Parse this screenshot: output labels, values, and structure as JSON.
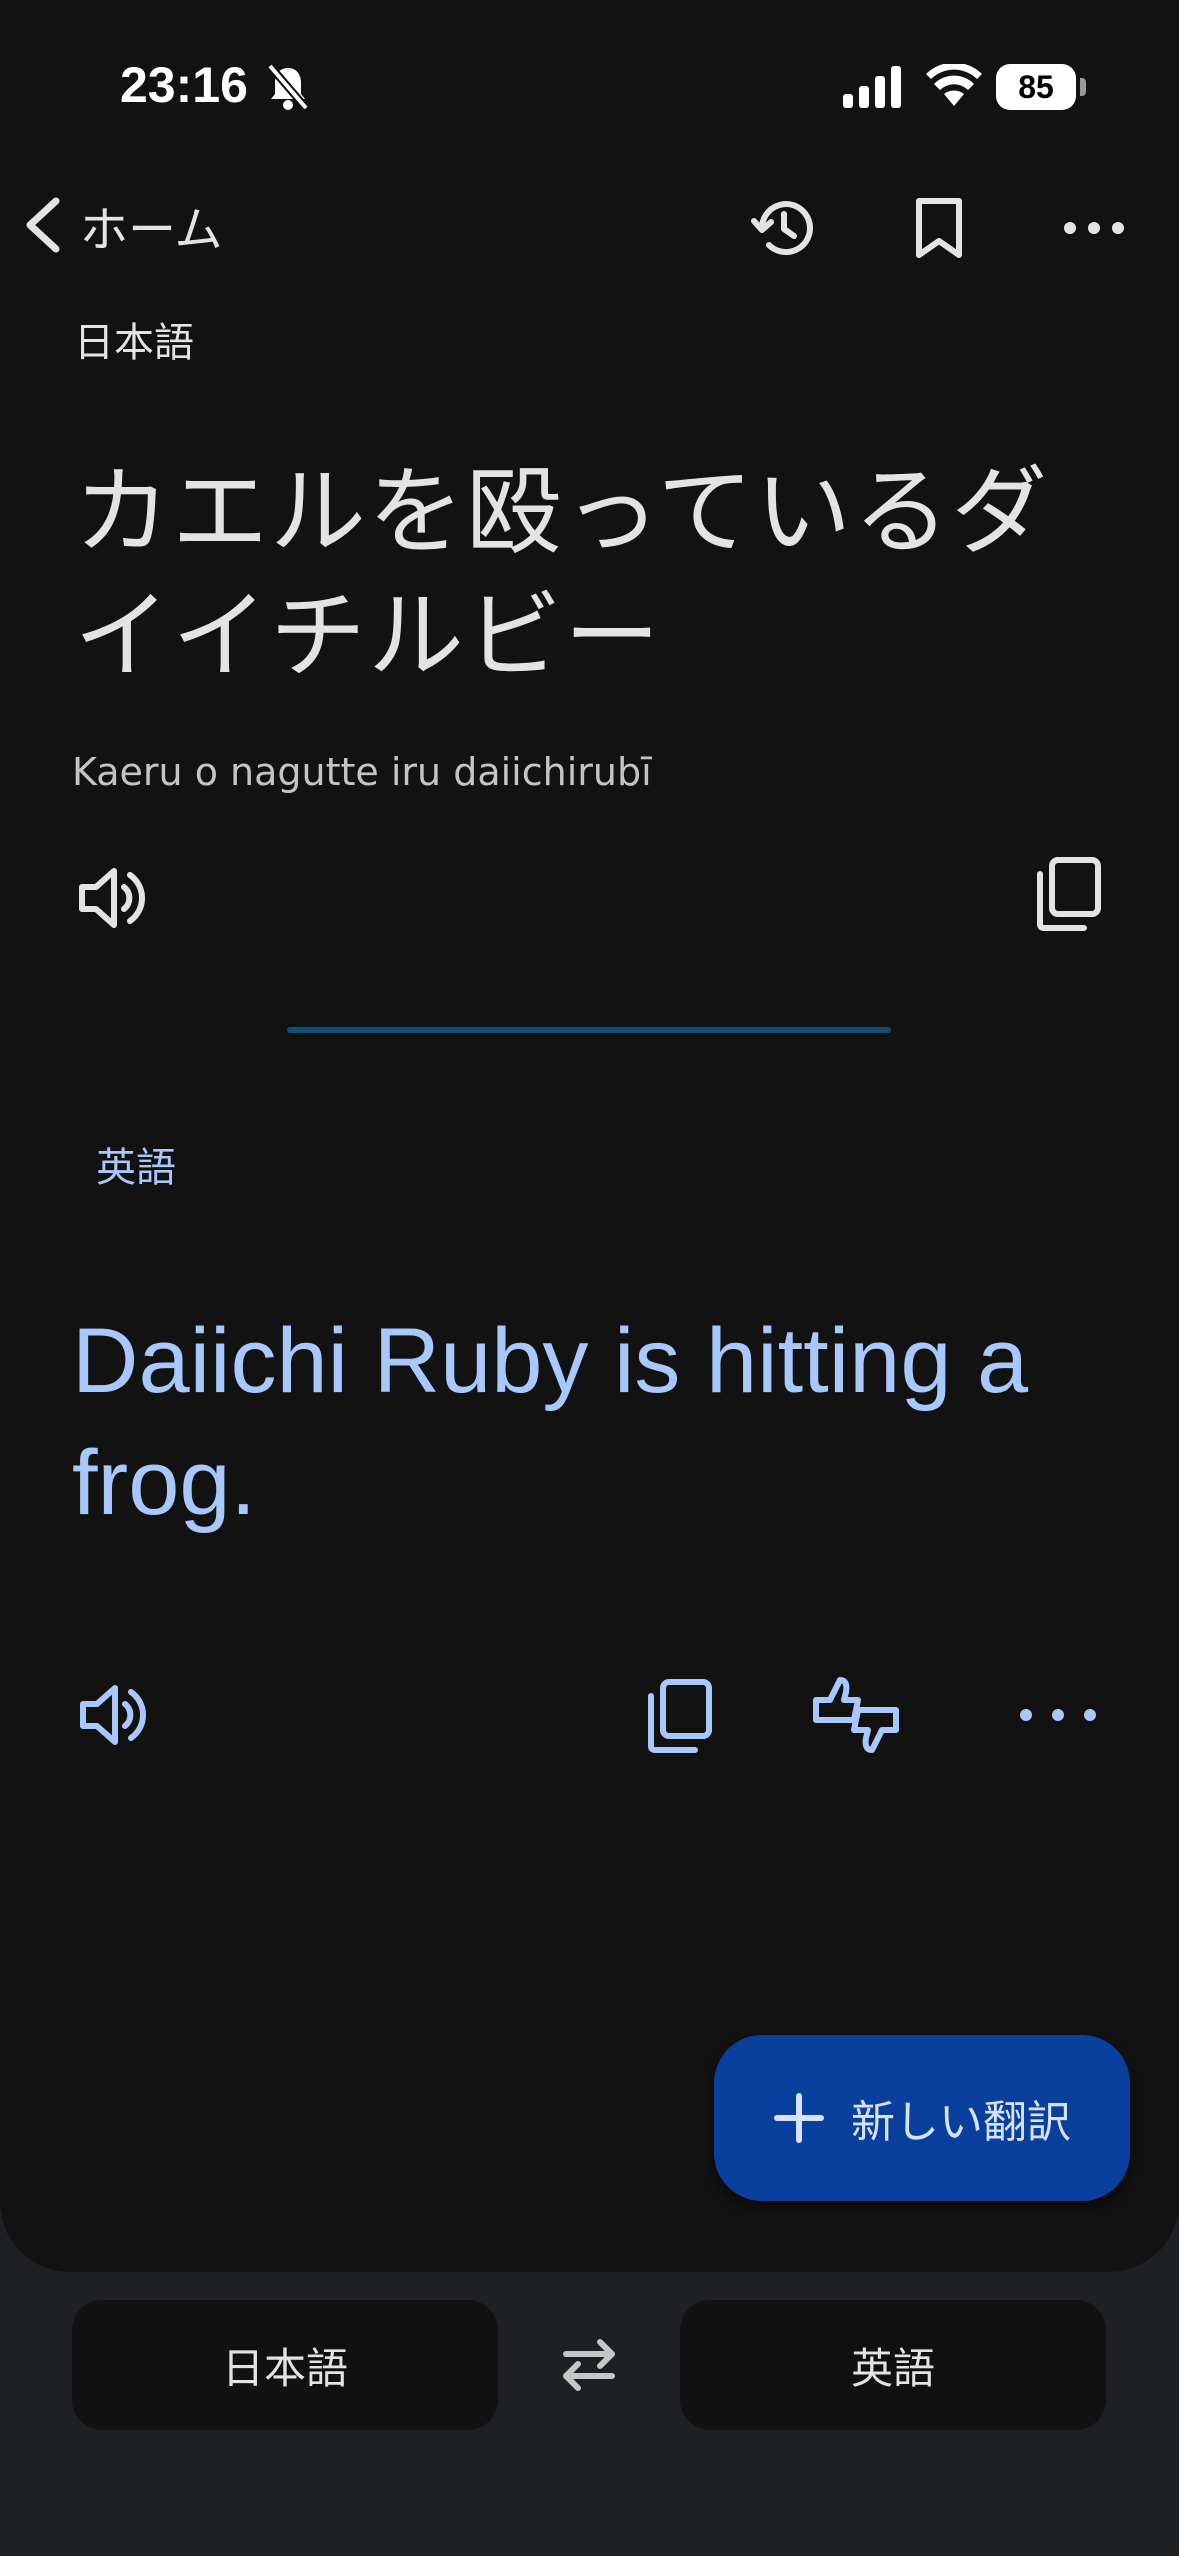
{
  "status_bar": {
    "time": "23:16",
    "battery": "85"
  },
  "header": {
    "back_label": "ホーム"
  },
  "source": {
    "language": "日本語",
    "text": "カエルを殴っているダイイチルビー",
    "romanization": "Kaeru o nagutte iru daiichirubī"
  },
  "target": {
    "language": "英語",
    "text": "Daiichi Ruby is hitting a frog."
  },
  "fab": {
    "label": "新しい翻訳"
  },
  "bottom_bar": {
    "source_language": "日本語",
    "target_language": "英語"
  },
  "colors": {
    "background": "#121213",
    "accent": "#a8c7fa",
    "fab": "#0b3f9e",
    "divider": "#0e4f78"
  },
  "icons": {
    "header": [
      "history-icon",
      "bookmark-icon",
      "more-vert-icon"
    ],
    "source_actions": [
      "speaker-icon",
      "copy-icon"
    ],
    "target_actions": [
      "speaker-icon",
      "copy-icon",
      "feedback-icon",
      "more-icon"
    ]
  }
}
